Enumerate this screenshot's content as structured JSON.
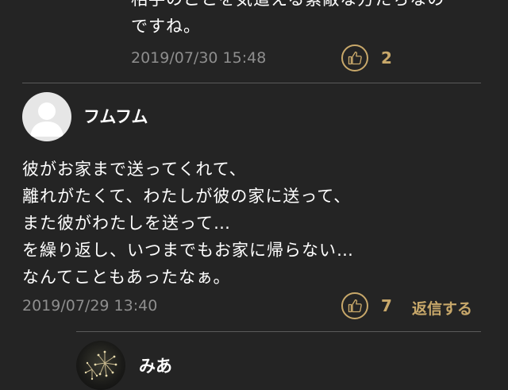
{
  "previous_comment": {
    "text": "相手のことを気遣える素敵な方たちなの\nですね。",
    "timestamp": "2019/07/30 15:48",
    "likes": "2",
    "like_icon": "thumbs-up-icon"
  },
  "comment": {
    "username": "フムフム",
    "avatar": "default-user-avatar",
    "text": "彼がお家まで送ってくれて、\n離れがたくて、わたしが彼の家に送って、\nまた彼がわたしを送って…\nを繰り返し、いつまでもお家に帰らない…\nなんてこともあったなぁ。",
    "timestamp": "2019/07/29 13:40",
    "likes": "7",
    "like_icon": "thumbs-up-icon",
    "reply_label": "返信する"
  },
  "reply": {
    "username": "みあ",
    "avatar": "fireworks-photo-avatar"
  },
  "colors": {
    "background": "#242424",
    "accent": "#c8a86a",
    "meta": "#8e8e8e",
    "divider": "#5a5a5a"
  }
}
